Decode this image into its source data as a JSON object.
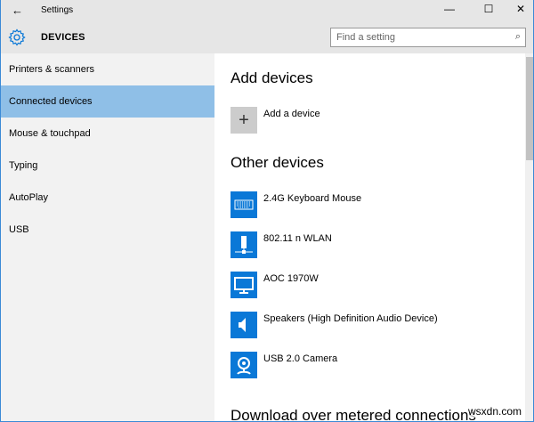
{
  "window": {
    "title": "Settings",
    "back": "←",
    "minimize": "—",
    "maximize": "☐",
    "close": "✕"
  },
  "header": {
    "title": "DEVICES",
    "search_placeholder": "Find a setting"
  },
  "sidebar": {
    "items": [
      {
        "label": "Printers & scanners"
      },
      {
        "label": "Connected devices"
      },
      {
        "label": "Mouse & touchpad"
      },
      {
        "label": "Typing"
      },
      {
        "label": "AutoPlay"
      },
      {
        "label": "USB"
      }
    ]
  },
  "main": {
    "add_heading": "Add devices",
    "add_label": "Add a device",
    "other_heading": "Other devices",
    "devices": [
      {
        "label": "2.4G Keyboard Mouse",
        "icon": "keyboard-icon"
      },
      {
        "label": "802.11 n WLAN",
        "icon": "network-adapter-icon"
      },
      {
        "label": "AOC 1970W",
        "icon": "monitor-icon"
      },
      {
        "label": "Speakers (High Definition Audio Device)",
        "icon": "speaker-icon"
      },
      {
        "label": "USB 2.0 Camera",
        "icon": "webcam-icon"
      }
    ],
    "download_heading": "Download over metered connections"
  },
  "watermark": "wsxdn.com",
  "colors": {
    "accent": "#0a78d7",
    "selected": "#8fbfe7"
  }
}
